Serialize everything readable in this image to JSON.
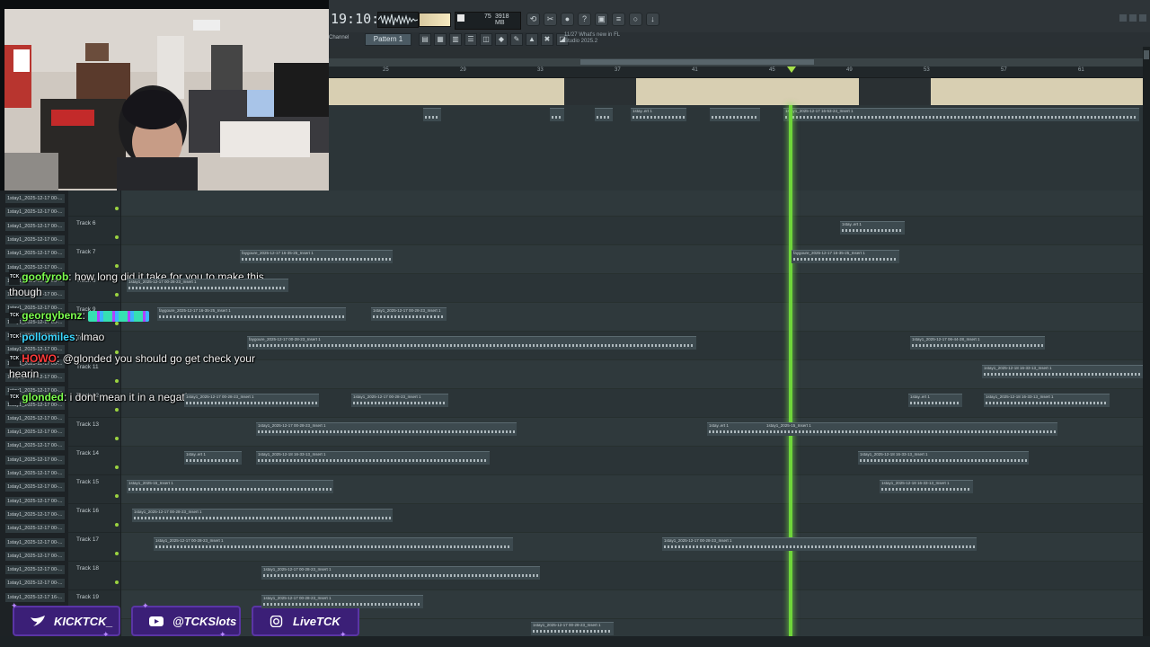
{
  "daw": {
    "clock": "19:10:16",
    "cpu_ram": "3918 MB",
    "cpu_small": "75",
    "pattern_label": "Pattern 1",
    "pattern_selector": "Channel",
    "news_line1": "11/27  What's new in FL",
    "news_line2": "Studio 2025.2",
    "ruler_numbers": [
      "25",
      "29",
      "33",
      "37",
      "41",
      "45",
      "49",
      "53",
      "57",
      "61",
      "65"
    ],
    "track_labels": [
      "Track 6",
      "Track 7",
      "Track 8",
      "Track 9",
      "Track 10",
      "Track 11",
      "Track 12",
      "Track 13",
      "Track 14",
      "Track 15",
      "Track 16",
      "Track 17",
      "Track 18",
      "Track 19"
    ],
    "browser_item_label": "1stay1_2025-12-17 00-...",
    "browser_last_label": "1stay1_2025-12-17 16-...",
    "clip_titles": {
      "a": "1stay1_2025-12-17 16-53-24_Insert 1",
      "b": "faygoure_2025-12-17 16-35-25_Insert 1",
      "c": "1stay..ert 1",
      "d": "1stay1_2025-12-17 00-28-23_Insert 1",
      "e": "1stay1_2025-12-17 06-44-28_Insert 1",
      "f": "1stay1_2025-12-18 16-33-13_Insert 1",
      "g": "1stay1_2025-15_Insert 1",
      "h": "faygoure_2025-12-17 00-28-23_Insert 1"
    }
  },
  "chat": [
    {
      "user": "goofyrob",
      "user_color": "#7cff4f",
      "text": "how long did it take for you to make this though",
      "emotes": false
    },
    {
      "user": "georgybenz",
      "user_color": "#7cff4f",
      "text": "",
      "emotes": true
    },
    {
      "user": "pollomiles",
      "user_color": "#3cd7ff",
      "text": "lmao",
      "emotes": false
    },
    {
      "user": "HOWO",
      "user_color": "#ff3b3b",
      "text": "@glonded you should go get check your hearin",
      "emotes": false
    },
    {
      "user": "glonded",
      "user_color": "#7cff4f",
      "text": "i dont mean it in a negative way",
      "emotes": false
    }
  ],
  "chat_badge": "TCK",
  "social": [
    {
      "platform": "kick-icon",
      "label": "KICKTCK_"
    },
    {
      "platform": "youtube-icon",
      "label": "@TCKSlots"
    },
    {
      "platform": "instagram-icon",
      "label": "LiveTCK"
    }
  ],
  "colors": {
    "accent_green": "#6fd63a",
    "social_bg": "#3b1f77",
    "social_border": "#5a35a5"
  }
}
